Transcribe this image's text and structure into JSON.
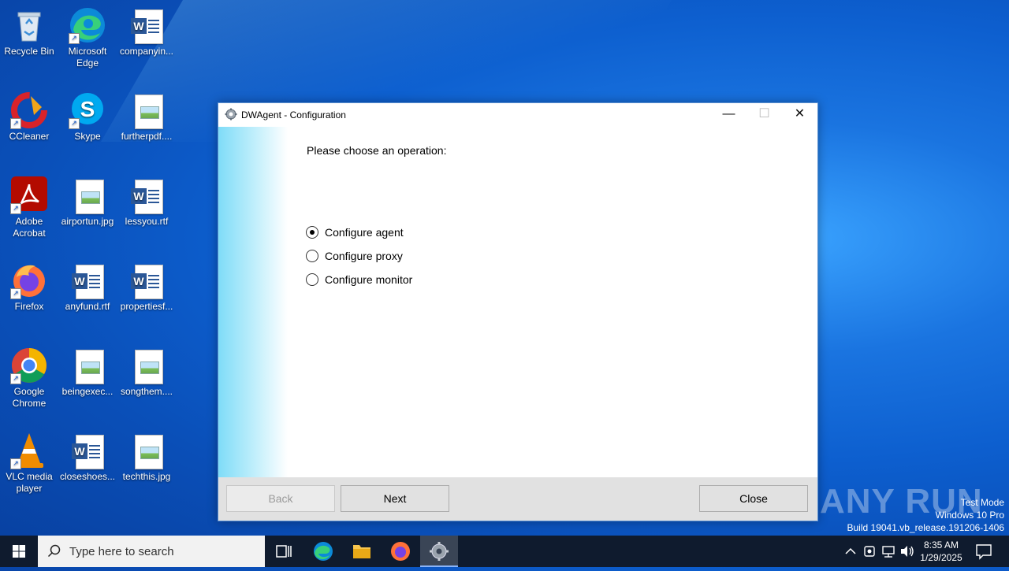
{
  "desktop": {
    "icons": [
      {
        "label": "Recycle Bin",
        "icon": "recycle-bin-icon"
      },
      {
        "label": "Microsoft Edge",
        "icon": "edge-icon"
      },
      {
        "label": "companyin...",
        "icon": "word-doc-icon"
      },
      {
        "label": "CCleaner",
        "icon": "ccleaner-icon"
      },
      {
        "label": "Skype",
        "icon": "skype-icon"
      },
      {
        "label": "furtherpdf....",
        "icon": "image-file-icon"
      },
      {
        "label": "Adobe Acrobat",
        "icon": "acrobat-icon"
      },
      {
        "label": "airportun.jpg",
        "icon": "image-file-icon"
      },
      {
        "label": "lessyou.rtf",
        "icon": "word-doc-icon"
      },
      {
        "label": "Firefox",
        "icon": "firefox-icon"
      },
      {
        "label": "anyfund.rtf",
        "icon": "word-doc-icon"
      },
      {
        "label": "propertiesf...",
        "icon": "word-doc-icon"
      },
      {
        "label": "Google Chrome",
        "icon": "chrome-icon"
      },
      {
        "label": "beingexec...",
        "icon": "image-file-icon"
      },
      {
        "label": "songthem....",
        "icon": "image-file-icon"
      },
      {
        "label": "VLC media player",
        "icon": "vlc-icon"
      },
      {
        "label": "closeshoes...",
        "icon": "word-doc-icon"
      },
      {
        "label": "techthis.jpg",
        "icon": "image-file-icon"
      }
    ]
  },
  "window": {
    "title": "DWAgent - Configuration",
    "prompt": "Please choose an operation:",
    "options": [
      {
        "label": "Configure agent",
        "checked": true
      },
      {
        "label": "Configure proxy",
        "checked": false
      },
      {
        "label": "Configure monitor",
        "checked": false
      }
    ],
    "buttons": {
      "back": "Back",
      "next": "Next",
      "close": "Close"
    },
    "back_disabled": true
  },
  "watermark": {
    "brand": "ANY RUN",
    "line1": "Test Mode",
    "line2": "Windows 10 Pro",
    "line3": "Build 19041.vb_release.191206-1406"
  },
  "taskbar": {
    "search_placeholder": "Type here to search",
    "time": "8:35 AM",
    "date": "1/29/2025"
  },
  "colors": {
    "taskbar": "#0f1b2e",
    "desktop_accent": "#1a74e0",
    "dialog_footer": "#e1e1e1"
  }
}
